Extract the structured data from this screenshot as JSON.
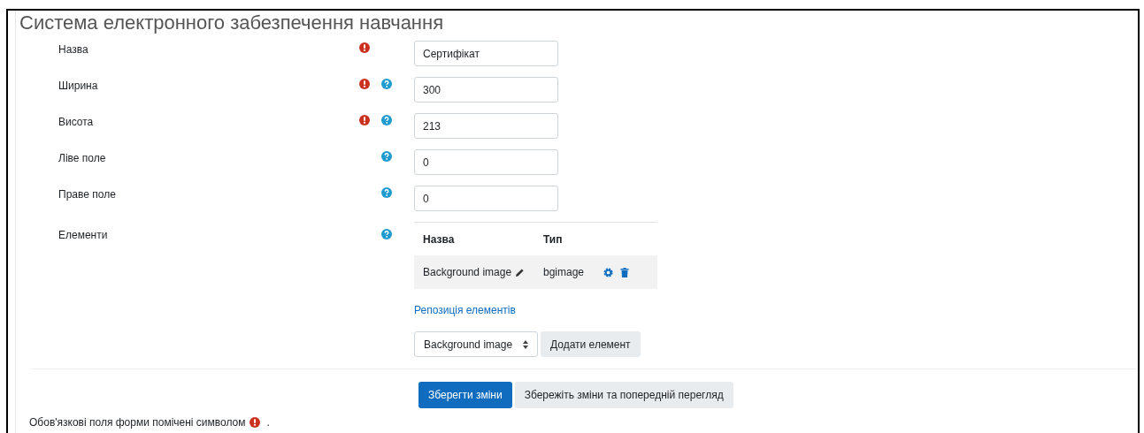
{
  "title": "Система електронного забезпечення навчання",
  "fields": [
    {
      "label": "Назва",
      "value": "Сертифікат",
      "required": true,
      "help": false
    },
    {
      "label": "Ширина",
      "value": "300",
      "required": true,
      "help": true
    },
    {
      "label": "Висота",
      "value": "213",
      "required": true,
      "help": true
    },
    {
      "label": "Ліве поле",
      "value": "0",
      "required": false,
      "help": true
    },
    {
      "label": "Праве поле",
      "value": "0",
      "required": false,
      "help": true
    }
  ],
  "elements": {
    "label": "Елементи",
    "help": true,
    "columns": [
      "Назва",
      "Тип"
    ],
    "rows": [
      {
        "name": "Background image",
        "type": "bgimage"
      }
    ],
    "link": "Репозиція елементів",
    "select": "Background image",
    "add_button": "Додати елемент"
  },
  "buttons": [
    {
      "label": "Зберегти зміни",
      "primary": true
    },
    {
      "label": "Збережіть зміни та попередній перегляд",
      "primary": false
    }
  ],
  "footer": {
    "before": "Обов'язкові поля форми помічені символом",
    "after": "."
  }
}
